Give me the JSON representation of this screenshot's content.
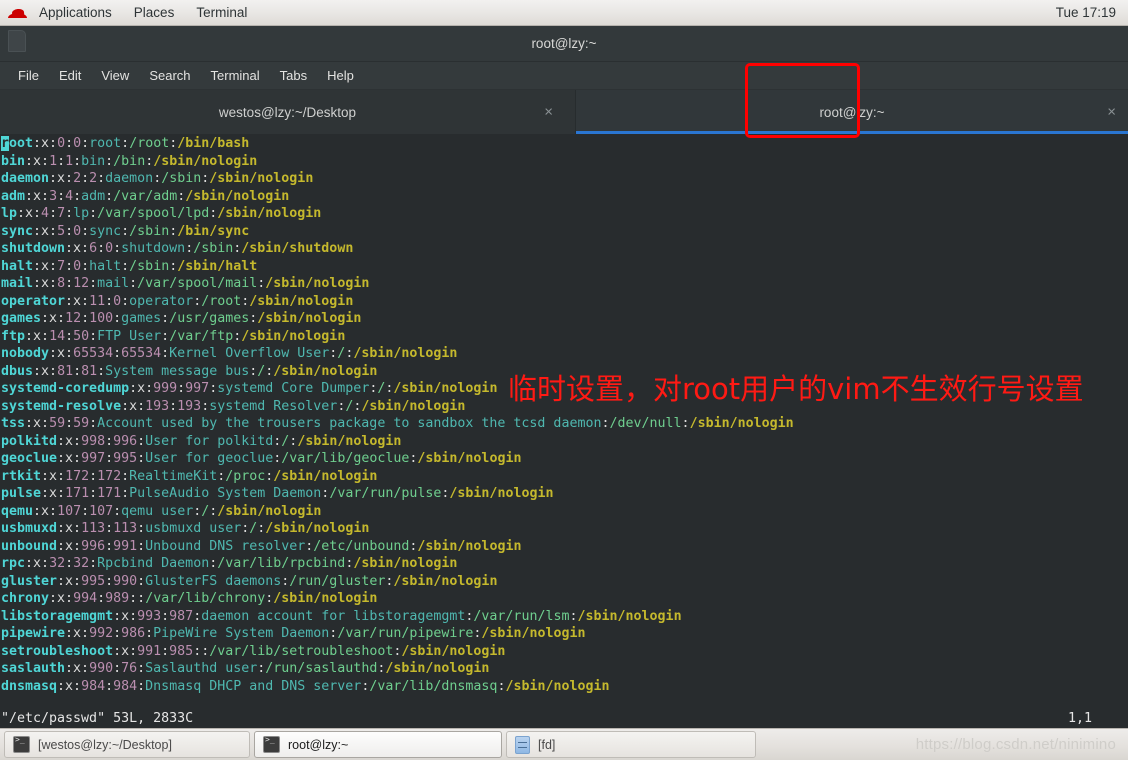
{
  "panel": {
    "logo_icon": "redhat-logo-icon",
    "menus": [
      "Applications",
      "Places",
      "Terminal"
    ],
    "clock": "Tue 17:19"
  },
  "window": {
    "title": "root@lzy:~",
    "icon": "terminal-window-icon",
    "menubar": [
      "File",
      "Edit",
      "View",
      "Search",
      "Terminal",
      "Tabs",
      "Help"
    ],
    "tabs": [
      {
        "label": "westos@lzy:~/Desktop",
        "active": false,
        "close_icon": "×"
      },
      {
        "label": "root@lzy:~",
        "active": true,
        "close_icon": "×"
      }
    ]
  },
  "annotation": {
    "text": "临时设置，对root用户的vim不生效行号设置",
    "color": "#ff1a14",
    "box_color": "#ff0000"
  },
  "editor": {
    "filename": "/etc/passwd",
    "status_line": "\"/etc/passwd\" 53L, 2833C",
    "cursor_position": "1,1",
    "colors": {
      "background": "#282c2e",
      "username": "#4fd6d6",
      "uid_gid": "#bb8fb0",
      "gecos": "#4fb8b0",
      "home": "#6fcf8f",
      "shell": "#c5b92d",
      "cursor": "#4fd6d6"
    },
    "lines": [
      {
        "user": "root",
        "uid": "0",
        "gid": "0",
        "gecos": "root",
        "home": "/root",
        "shell": "/bin/bash",
        "cursor": true
      },
      {
        "user": "bin",
        "uid": "1",
        "gid": "1",
        "gecos": "bin",
        "home": "/bin",
        "shell": "/sbin/nologin"
      },
      {
        "user": "daemon",
        "uid": "2",
        "gid": "2",
        "gecos": "daemon",
        "home": "/sbin",
        "shell": "/sbin/nologin"
      },
      {
        "user": "adm",
        "uid": "3",
        "gid": "4",
        "gecos": "adm",
        "home": "/var/adm",
        "shell": "/sbin/nologin"
      },
      {
        "user": "lp",
        "uid": "4",
        "gid": "7",
        "gecos": "lp",
        "home": "/var/spool/lpd",
        "shell": "/sbin/nologin"
      },
      {
        "user": "sync",
        "uid": "5",
        "gid": "0",
        "gecos": "sync",
        "home": "/sbin",
        "shell": "/bin/sync"
      },
      {
        "user": "shutdown",
        "uid": "6",
        "gid": "0",
        "gecos": "shutdown",
        "home": "/sbin",
        "shell": "/sbin/shutdown"
      },
      {
        "user": "halt",
        "uid": "7",
        "gid": "0",
        "gecos": "halt",
        "home": "/sbin",
        "shell": "/sbin/halt"
      },
      {
        "user": "mail",
        "uid": "8",
        "gid": "12",
        "gecos": "mail",
        "home": "/var/spool/mail",
        "shell": "/sbin/nologin"
      },
      {
        "user": "operator",
        "uid": "11",
        "gid": "0",
        "gecos": "operator",
        "home": "/root",
        "shell": "/sbin/nologin"
      },
      {
        "user": "games",
        "uid": "12",
        "gid": "100",
        "gecos": "games",
        "home": "/usr/games",
        "shell": "/sbin/nologin"
      },
      {
        "user": "ftp",
        "uid": "14",
        "gid": "50",
        "gecos": "FTP User",
        "home": "/var/ftp",
        "shell": "/sbin/nologin"
      },
      {
        "user": "nobody",
        "uid": "65534",
        "gid": "65534",
        "gecos": "Kernel Overflow User",
        "home": "/",
        "shell": "/sbin/nologin"
      },
      {
        "user": "dbus",
        "uid": "81",
        "gid": "81",
        "gecos": "System message bus",
        "home": "/",
        "shell": "/sbin/nologin"
      },
      {
        "user": "systemd-coredump",
        "uid": "999",
        "gid": "997",
        "gecos": "systemd Core Dumper",
        "home": "/",
        "shell": "/sbin/nologin"
      },
      {
        "user": "systemd-resolve",
        "uid": "193",
        "gid": "193",
        "gecos": "systemd Resolver",
        "home": "/",
        "shell": "/sbin/nologin"
      },
      {
        "user": "tss",
        "uid": "59",
        "gid": "59",
        "gecos": "Account used by the trousers package to sandbox the tcsd daemon",
        "home": "/dev/null",
        "shell": "/sbin/nologin"
      },
      {
        "user": "polkitd",
        "uid": "998",
        "gid": "996",
        "gecos": "User for polkitd",
        "home": "/",
        "shell": "/sbin/nologin"
      },
      {
        "user": "geoclue",
        "uid": "997",
        "gid": "995",
        "gecos": "User for geoclue",
        "home": "/var/lib/geoclue",
        "shell": "/sbin/nologin"
      },
      {
        "user": "rtkit",
        "uid": "172",
        "gid": "172",
        "gecos": "RealtimeKit",
        "home": "/proc",
        "shell": "/sbin/nologin"
      },
      {
        "user": "pulse",
        "uid": "171",
        "gid": "171",
        "gecos": "PulseAudio System Daemon",
        "home": "/var/run/pulse",
        "shell": "/sbin/nologin"
      },
      {
        "user": "qemu",
        "uid": "107",
        "gid": "107",
        "gecos": "qemu user",
        "home": "/",
        "shell": "/sbin/nologin"
      },
      {
        "user": "usbmuxd",
        "uid": "113",
        "gid": "113",
        "gecos": "usbmuxd user",
        "home": "/",
        "shell": "/sbin/nologin"
      },
      {
        "user": "unbound",
        "uid": "996",
        "gid": "991",
        "gecos": "Unbound DNS resolver",
        "home": "/etc/unbound",
        "shell": "/sbin/nologin"
      },
      {
        "user": "rpc",
        "uid": "32",
        "gid": "32",
        "gecos": "Rpcbind Daemon",
        "home": "/var/lib/rpcbind",
        "shell": "/sbin/nologin"
      },
      {
        "user": "gluster",
        "uid": "995",
        "gid": "990",
        "gecos": "GlusterFS daemons",
        "home": "/run/gluster",
        "shell": "/sbin/nologin"
      },
      {
        "user": "chrony",
        "uid": "994",
        "gid": "989",
        "gecos": "",
        "home": "/var/lib/chrony",
        "shell": "/sbin/nologin"
      },
      {
        "user": "libstoragemgmt",
        "uid": "993",
        "gid": "987",
        "gecos": "daemon account for libstoragemgmt",
        "home": "/var/run/lsm",
        "shell": "/sbin/nologin"
      },
      {
        "user": "pipewire",
        "uid": "992",
        "gid": "986",
        "gecos": "PipeWire System Daemon",
        "home": "/var/run/pipewire",
        "shell": "/sbin/nologin"
      },
      {
        "user": "setroubleshoot",
        "uid": "991",
        "gid": "985",
        "gecos": "",
        "home": "/var/lib/setroubleshoot",
        "shell": "/sbin/nologin"
      },
      {
        "user": "saslauth",
        "uid": "990",
        "gid": "76",
        "gecos": "Saslauthd user",
        "home": "/run/saslauthd",
        "shell": "/sbin/nologin"
      },
      {
        "user": "dnsmasq",
        "uid": "984",
        "gid": "984",
        "gecos": "Dnsmasq DHCP and DNS server",
        "home": "/var/lib/dnsmasq",
        "shell": "/sbin/nologin"
      }
    ]
  },
  "taskbar": {
    "items": [
      {
        "label": "[westos@lzy:~/Desktop]",
        "icon": "terminal-icon",
        "active": false
      },
      {
        "label": "root@lzy:~",
        "icon": "terminal-icon",
        "active": true
      },
      {
        "label": "[fd]",
        "icon": "file-manager-icon",
        "active": false
      }
    ],
    "watermark": "https://blog.csdn.net/ninimino"
  }
}
